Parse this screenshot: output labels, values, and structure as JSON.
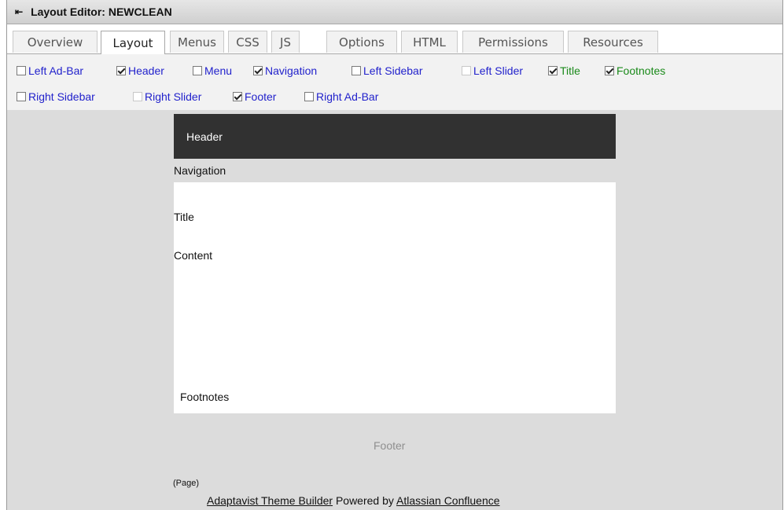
{
  "titlebar": {
    "title": "Layout Editor: NEWCLEAN"
  },
  "tabs": [
    {
      "label": "Overview"
    },
    {
      "label": "Layout"
    },
    {
      "label": "Menus"
    },
    {
      "label": "CSS"
    },
    {
      "label": "JS"
    },
    {
      "label": "Options"
    },
    {
      "label": "HTML"
    },
    {
      "label": "Permissions"
    },
    {
      "label": "Resources"
    }
  ],
  "active_tab": "Layout",
  "options": [
    {
      "label": "Left Ad-Bar",
      "checked": false
    },
    {
      "label": "Header",
      "checked": true
    },
    {
      "label": "Menu",
      "checked": false
    },
    {
      "label": "Navigation",
      "checked": true
    },
    {
      "label": "Left Sidebar",
      "checked": false
    },
    {
      "label": "Left Slider",
      "checked": false
    },
    {
      "label": "Title",
      "checked": true
    },
    {
      "label": "Footnotes",
      "checked": true
    },
    {
      "label": "Right Sidebar",
      "checked": false
    },
    {
      "label": "Right Slider",
      "checked": false
    },
    {
      "label": "Footer",
      "checked": true
    },
    {
      "label": "Right Ad-Bar",
      "checked": false
    }
  ],
  "colors": {
    "option_link": "#2222cc",
    "option_green": "#1a8a1a",
    "header_bg": "#313131",
    "canvas_bg": "#dcdcdc"
  },
  "preview": {
    "header": "Header",
    "navigation": "Navigation",
    "title": "Title",
    "content": "Content",
    "footnotes": "Footnotes",
    "footer": "Footer",
    "page": "(Page)",
    "powered": {
      "link1": "Adaptavist Theme Builder",
      "middle": " Powered by ",
      "link2": "Atlassian Confluence"
    }
  }
}
